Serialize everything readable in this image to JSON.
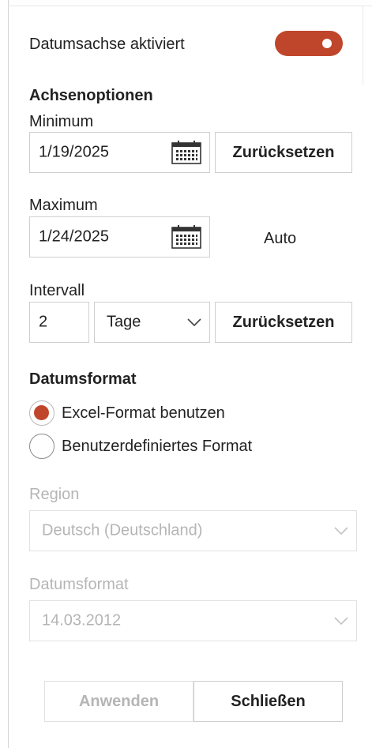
{
  "header": {
    "date_axis_label": "Datumsachse aktiviert",
    "date_axis_enabled": true
  },
  "axis_options": {
    "heading": "Achsenoptionen",
    "minimum_label": "Minimum",
    "minimum_value": "1/19/2025",
    "reset_label": "Zurücksetzen",
    "maximum_label": "Maximum",
    "maximum_value": "1/24/2025",
    "maximum_auto": "Auto",
    "interval_label": "Intervall",
    "interval_value": "2",
    "interval_unit": "Tage"
  },
  "date_format": {
    "heading": "Datumsformat",
    "options": [
      {
        "label": "Excel-Format benutzen",
        "selected": true
      },
      {
        "label": "Benutzerdefiniertes Format",
        "selected": false
      }
    ],
    "region_label": "Region",
    "region_value": "Deutsch (Deutschland)",
    "format_label": "Datumsformat",
    "format_value": "14.03.2012"
  },
  "footer": {
    "apply_label": "Anwenden",
    "close_label": "Schließen"
  },
  "colors": {
    "accent": "#c0462b",
    "disabled_text": "#b5b5b5",
    "border": "#cfcfcf"
  }
}
